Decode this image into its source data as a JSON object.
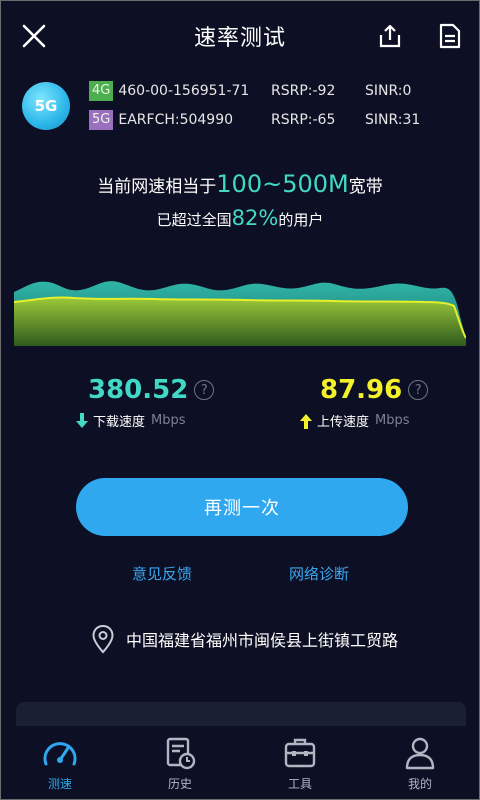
{
  "header": {
    "title": "速率测试"
  },
  "network": {
    "badge": "5G",
    "rows": [
      {
        "tag": "4G",
        "id": "460-00-156951-71",
        "rsrp": "RSRP:-92",
        "sinr": "SINR:0"
      },
      {
        "tag": "5G",
        "id": "EARFCH:504990",
        "rsrp": "RSRP:-65",
        "sinr": "SINR:31"
      }
    ]
  },
  "summary": {
    "line1_prefix": "当前网速相当于",
    "line1_value": "100~500M",
    "line1_suffix": "宽带",
    "line2_prefix": "已超过全国",
    "line2_value": "82%",
    "line2_suffix": "的用户"
  },
  "download": {
    "value": "380.52",
    "label": "下载速度",
    "unit": "Mbps",
    "help": "?",
    "color": "#41d9c6"
  },
  "upload": {
    "value": "87.96",
    "label": "上传速度",
    "unit": "Mbps",
    "help": "?",
    "color": "#f4f02a"
  },
  "actions": {
    "retest": "再测一次",
    "feedback": "意见反馈",
    "diagnose": "网络诊断"
  },
  "location": {
    "address": "中国福建省福州市闽侯县上街镇工贸路"
  },
  "tabs": [
    {
      "label": "测速",
      "icon": "speedometer-icon",
      "active": true
    },
    {
      "label": "历史",
      "icon": "history-icon",
      "active": false
    },
    {
      "label": "工具",
      "icon": "toolbox-icon",
      "active": false
    },
    {
      "label": "我的",
      "icon": "user-icon",
      "active": false
    }
  ],
  "colors": {
    "background": "#0d1024",
    "accent": "#2fa8f0",
    "teal": "#41d9c6",
    "yellow": "#f4f02a"
  }
}
